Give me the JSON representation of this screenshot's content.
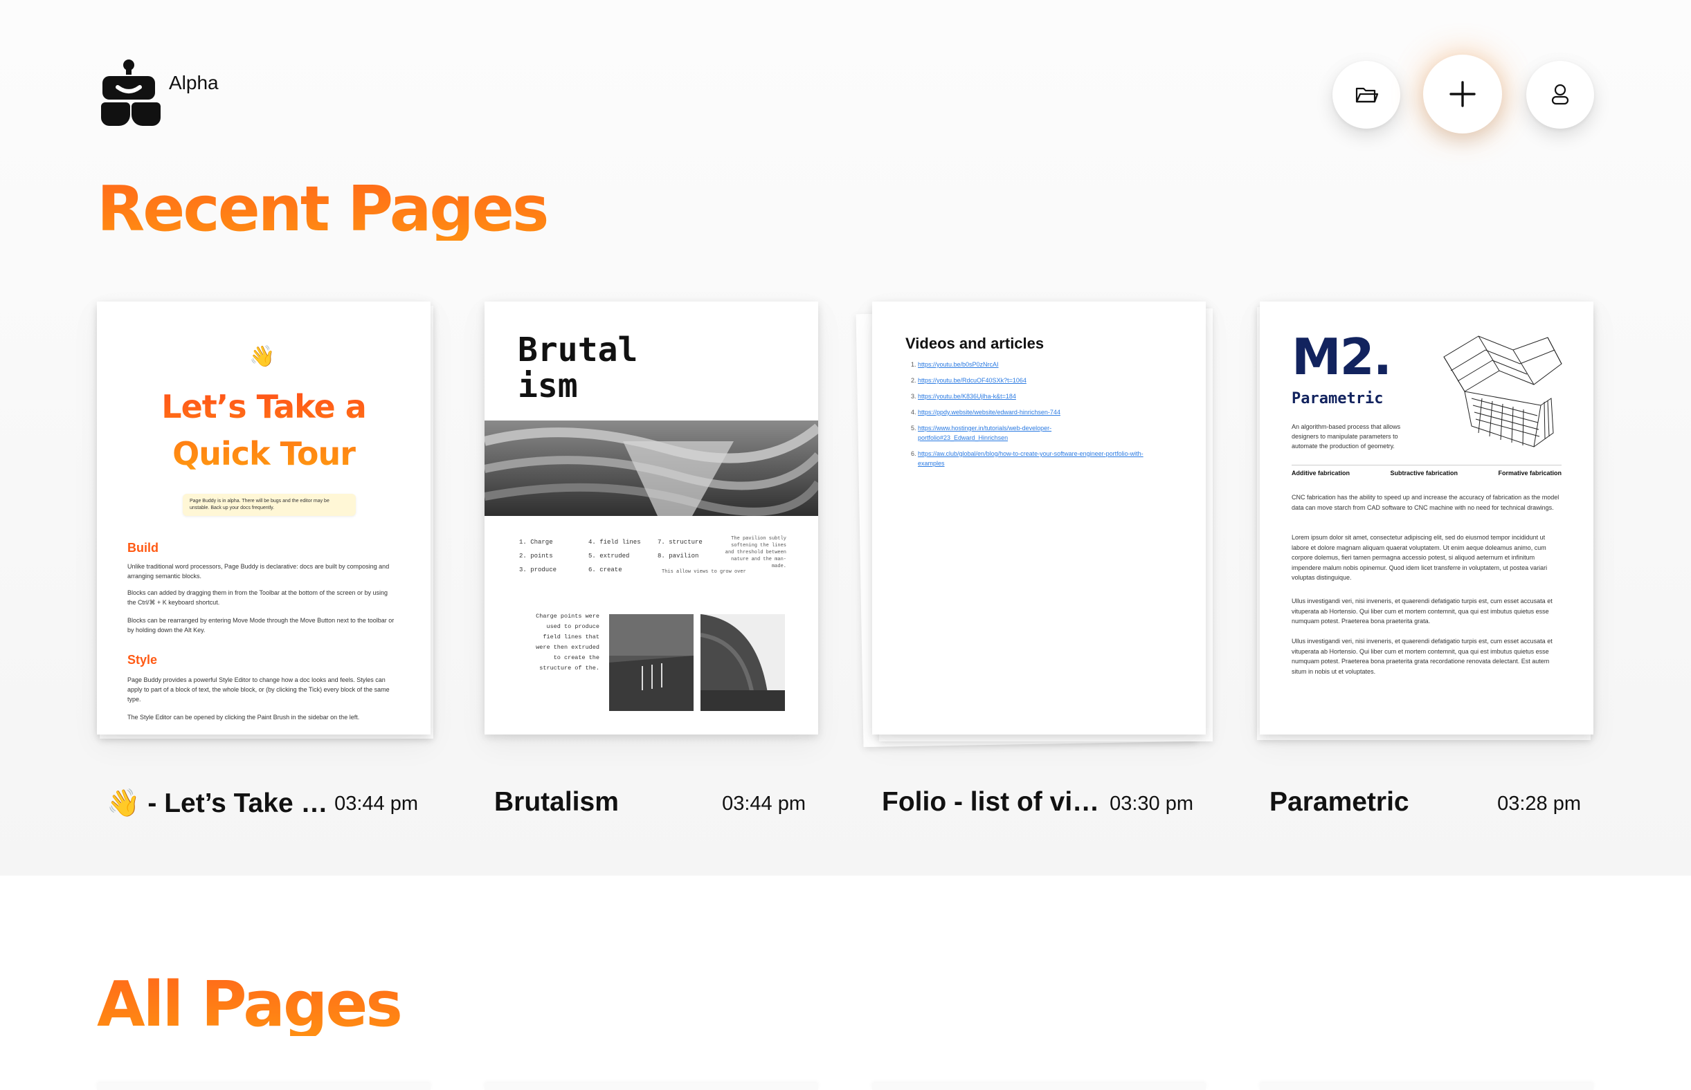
{
  "app": {
    "name": "Alpha"
  },
  "toolbar": {
    "folder_icon": "folder-icon",
    "new_icon": "plus-icon",
    "profile_icon": "user-icon"
  },
  "sections": {
    "recent": "Recent Pages",
    "all": "All Pages"
  },
  "colors": {
    "accent_start": "#ff6a1a",
    "accent_end": "#ff8e12",
    "navy": "#12235e",
    "link": "#2a7ae2"
  },
  "recent_pages": [
    {
      "title": "👋 - Let’s Take a Quick Tour",
      "time": "03:44 pm",
      "preview": {
        "emoji": "👋",
        "heading_line1": "Let’s Take a",
        "heading_line2": "Quick Tour",
        "note": "Page Buddy is in alpha. There will be bugs and the editor may be unstable. Back up your docs frequently.",
        "section1_heading": "Build",
        "section1_p1": "Unlike traditional word processors, Page Buddy is declarative: docs are built by composing and arranging semantic blocks.",
        "section1_p2": "Blocks can added by dragging them in from the Toolbar at the bottom of the screen or by using the Ctrl/⌘ + K keyboard shortcut.",
        "section1_p3": "Blocks can be rearranged by entering Move Mode through the Move Button next to the toolbar or by holding down the Alt Key.",
        "section2_heading": "Style",
        "section2_p1": "Page Buddy provides a powerful Style Editor to change how a doc looks and feels. Styles can apply to part of a block of text, the whole block, or (by clicking the Tick) every block of the same type.",
        "section2_p2": "The Style Editor can be opened by clicking the Paint Brush in the sidebar on the left."
      }
    },
    {
      "title": "Brutalism",
      "time": "03:44 pm",
      "preview": {
        "heading_line1": "Brutal",
        "heading_line2": "ism",
        "list_col1": [
          "Charge",
          "points",
          "produce"
        ],
        "list_col2": [
          "field lines",
          "extruded",
          "create"
        ],
        "list_col3": [
          "structure",
          "pavilion"
        ],
        "note_right": "The pavilion subtly softening the lines and threshold between nature and the man-made.",
        "note_center": "This allow views to grow over",
        "side_text": "Charge points were used to produce field lines that were then extruded to create the structure of the."
      }
    },
    {
      "title": "Folio - list of videos and articles",
      "time": "03:30 pm",
      "preview": {
        "heading": "Videos and articles",
        "links": [
          "https://youtu.be/b0sP0zNrcAI",
          "https://youtu.be/RdcuOF40SXk?t=1064",
          "https://youtu.be/K836Ujlha-k&t=184",
          "https://ppdy.website/website/edward-hinrichsen-744",
          "https://www.hostinger.in/tutorials/web-developer-portfolio#23_Edward_Hinrichsen",
          "https://aw.club/global/en/blog/how-to-create-your-software-engineer-portfolio-with-examples"
        ]
      }
    },
    {
      "title": "Parametric",
      "time": "03:28 pm",
      "preview": {
        "big": "M2.",
        "subtitle": "Parametric",
        "intro": "An algorithm-based process that allows designers to manipulate parameters to automate the production of geometry.",
        "labels": [
          "Additive fabrication",
          "Subtractive fabrication",
          "Formative fabrication"
        ],
        "p1": "CNC fabrication has the ability to speed up and increase the accuracy of fabrication as the model data can move starch from CAD software to CNC machine with no need for technical drawings.",
        "p2": "Lorem ipsum dolor sit amet, consectetur adipiscing elit, sed do eiusmod tempor incididunt ut labore et dolore magnam aliquam quaerat voluptatem. Ut enim aeque doleamus animo, cum corpore dolemus, fieri tamen permagna accessio potest, si aliquod aeternum et infinitum impendere malum nobis opinemur. Quod idem licet transferre in voluptatem, ut postea variari voluptas distinguique.",
        "p3": "Ullus investigandi veri, nisi inveneris, et quaerendi defatigatio turpis est, cum esset accusata et vituperata ab Hortensio. Qui liber cum et mortem contemnit, qua qui est imbutus quietus esse numquam potest. Praeterea bona praeterita grata.",
        "p4": "Ullus investigandi veri, nisi inveneris, et quaerendi defatigatio turpis est, cum esset accusata et vituperata ab Hortensio. Qui liber cum et mortem contemnit, qua qui est imbutus quietus esse numquam potest. Praeterea bona praeterita grata recordatione renovata delectant. Est autem situm in nobis ut et voluptates."
      }
    }
  ]
}
